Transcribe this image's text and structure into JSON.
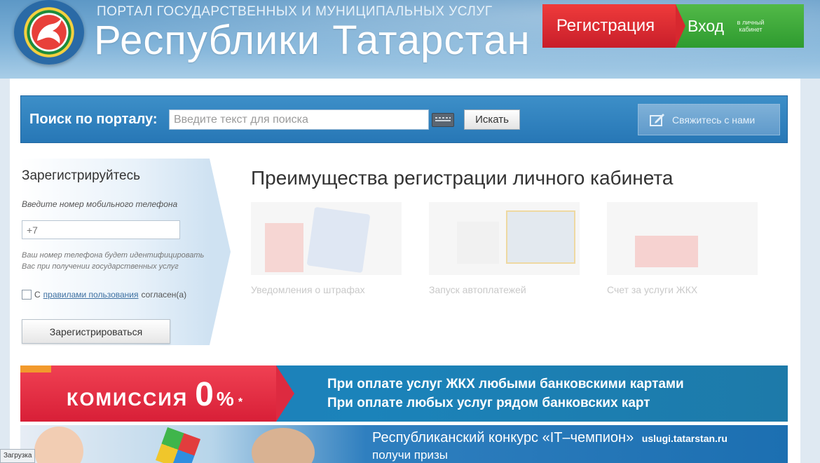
{
  "header": {
    "subtitle": "ПОРТАЛ ГОСУДАРСТВЕННЫХ И МУНИЦИПАЛЬНЫХ УСЛУГ",
    "title": "Республики Татарстан",
    "register_label": "Регистрация",
    "login_label": "Вход",
    "login_sub": "в личный кабинет"
  },
  "search": {
    "label": "Поиск по порталу:",
    "placeholder": "Введите текст для поиска",
    "button": "Искать",
    "contact": "Свяжитесь с нами"
  },
  "register": {
    "title": "Зарегистрируйтесь",
    "phone_label": "Введите номер мобильного телефона",
    "phone_value": "+7",
    "hint": "Ваш номер телефона будет идентифицировать Вас при получении государственных услуг",
    "agree_prefix": "С",
    "agree_link": "правилами пользования",
    "agree_suffix": "согласен(а)",
    "submit": "Зарегистрироваться"
  },
  "benefits": {
    "title": "Преимущества регистрации личного кабинета",
    "items": [
      {
        "caption": "Уведомления о штрафах",
        "desc": ""
      },
      {
        "caption": "Запуск автоплатежей",
        "desc": ""
      },
      {
        "caption": "Счет за услуги ЖКХ",
        "desc": ""
      }
    ]
  },
  "promo": {
    "fee_word": "КОМИССИЯ",
    "fee_value": "0",
    "fee_percent": "%",
    "fee_star": "*",
    "line1": "При оплате услуг ЖКХ любыми банковскими картами",
    "line2": "При оплате любых услуг рядом банковских карт"
  },
  "contest": {
    "title": "Республиканский конкурс «IT–чемпион»",
    "url": "uslugi.tatarstan.ru",
    "sub": "получи призы"
  },
  "status": {
    "text": "Загрузка"
  },
  "colors": {
    "register": "#d7282f",
    "login": "#3aa83a",
    "search_bar": "#2b7bbb",
    "promo_red": "#dd2a40"
  }
}
